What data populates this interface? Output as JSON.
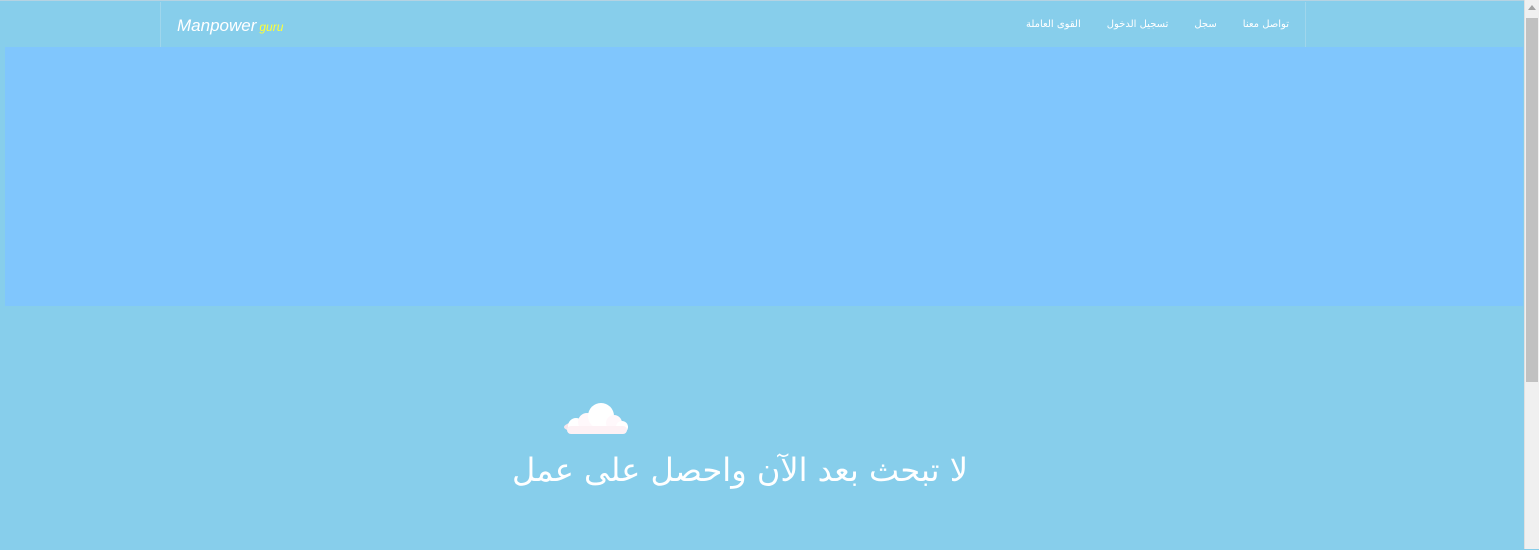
{
  "navbar": {
    "brand_main": "Manpower",
    "brand_sub": "guru",
    "links": [
      "تواصل معنا",
      "سجل",
      "تسجيل الدخول",
      "القوى العاملة"
    ]
  },
  "hero": {
    "tagline": "لا تبحث بعد الآن واحصل على عمل"
  },
  "icons": {
    "cloud": "cloud-icon"
  },
  "colors": {
    "background": "#87ceeb",
    "hero_banner": "#80c6fd",
    "brand_accent": "#ffff33",
    "text": "#ffffff"
  }
}
